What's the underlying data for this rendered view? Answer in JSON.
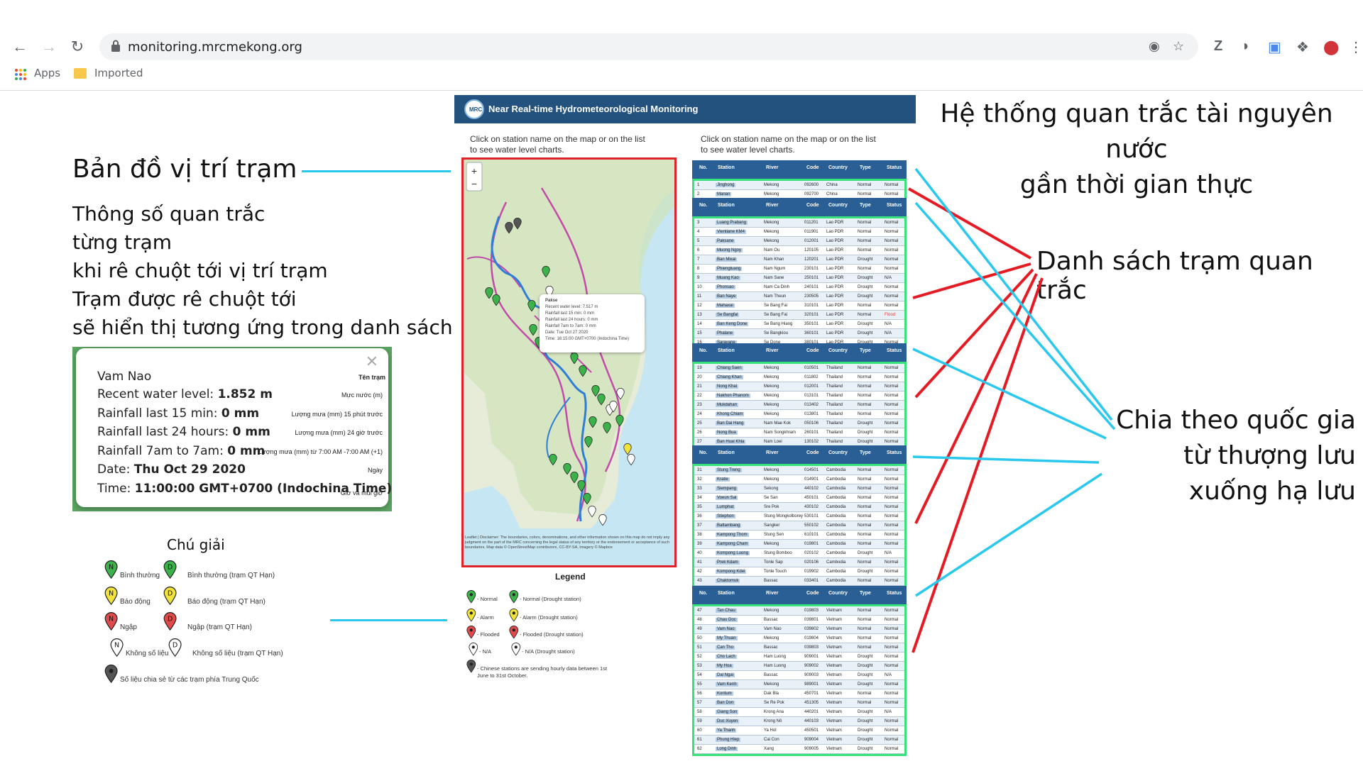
{
  "browser": {
    "url": "monitoring.mrcmekong.org",
    "bookmarks": [
      "Apps",
      "Imported"
    ],
    "ext_letter": "Z"
  },
  "annotations": {
    "map_title": "Bản đồ vị trí trạm",
    "hover_lines": [
      "Thông số quan trắc",
      "từng trạm",
      "khi rê chuột tới vị trí trạm",
      "Trạm được rê chuột tới",
      "sẽ hiển thị tương ứng trong danh sách"
    ],
    "system_lines": [
      "Hệ thống quan trắc tài nguyên nước",
      "gần thời gian thực"
    ],
    "station_list": "Danh sách trạm quan trắc",
    "country_lines": [
      "Chia theo quốc gia",
      "từ thượng lưu",
      "xuống hạ lưu"
    ],
    "legend_vi_title": "Chú giải"
  },
  "popup": {
    "station": "Vam Nao",
    "station_note": "Tên trạm",
    "rows": [
      {
        "label": "Recent water level: ",
        "value": "1.852 m",
        "note": "Mực nước (m)"
      },
      {
        "label": "Rainfall last 15 min: ",
        "value": "0 mm",
        "note": "Lượng mưa (mm) 15 phút trước"
      },
      {
        "label": "Rainfall last 24 hours: ",
        "value": "0 mm",
        "note": "Lượng mưa (mm) 24 giờ trước"
      },
      {
        "label": "Rainfall 7am to 7am: ",
        "value": "0 mm",
        "note": "Lượng mưa (mm) từ 7:00 AM -7:00 AM (+1)"
      },
      {
        "label": "Date: ",
        "value": "Thu Oct 29 2020",
        "note": "Ngày"
      },
      {
        "label": "Time: ",
        "value": "11:00:00 GMT+0700 (Indochina Time)",
        "note": "Giờ và múi giờ"
      }
    ]
  },
  "legend_vi": [
    {
      "text": "Bình thường",
      "letter": "N",
      "color": "#3bb34a"
    },
    {
      "text": "Bình thường (trạm QT Hạn)",
      "letter": "D",
      "color": "#3bb34a"
    },
    {
      "text": "Báo động",
      "letter": "N",
      "color": "#f2e33a"
    },
    {
      "text": "Báo động (trạm QT Hạn)",
      "letter": "D",
      "color": "#f2e33a"
    },
    {
      "text": "Ngập",
      "letter": "N",
      "color": "#e04a4a"
    },
    {
      "text": "Ngập (trạm QT Hạn)",
      "letter": "D",
      "color": "#e04a4a"
    },
    {
      "text": "Không số liệu",
      "letter": "N",
      "color": "#ffffff"
    },
    {
      "text": "Không số liệu (trạm QT Hạn)",
      "letter": "D",
      "color": "#ffffff"
    },
    {
      "text": "Số liệu chia sẻ từ các trạm phía Trung Quốc",
      "letter": "",
      "color": "#555555"
    }
  ],
  "portal": {
    "title": "Near Real-time Hydrometeorological Monitoring",
    "hint_left": [
      "Click on station name on the map or on the list",
      "to see water level charts."
    ],
    "hint_right": [
      "Click on station name on the map or on the list",
      "to see water level charts."
    ],
    "zoom_in": "+",
    "zoom_out": "−",
    "legend_title": "Legend",
    "legend_en": [
      {
        "text": "- Normal",
        "color": "#3bb34a"
      },
      {
        "text": "- Normal (Drought station)",
        "color": "#3bb34a"
      },
      {
        "text": "- Alarm",
        "color": "#f2e33a"
      },
      {
        "text": "- Alarm (Drought station)",
        "color": "#f2e33a"
      },
      {
        "text": "- Flooded",
        "color": "#e04a4a"
      },
      {
        "text": "- Flooded (Drought station)",
        "color": "#e04a4a"
      },
      {
        "text": "- N/A",
        "color": "#ffffff"
      },
      {
        "text": "- N/A (Drought station)",
        "color": "#ffffff"
      },
      {
        "text": "- Chinese stations are sending hourly data between 1st June to 31st October.",
        "color": "#555555"
      }
    ],
    "map_popup": {
      "station": "Pakse",
      "lines": [
        "Recent water level: 7.517 m",
        "Rainfall last 15 min: 0 mm",
        "Rainfall last 24 hours: 0 mm",
        "Rainfall 7am to 7am: 0 mm",
        "Date: Tue Oct 27 2020",
        "Time: 16:15:00 GMT+0700 (Indochina Time)"
      ]
    },
    "map_attrib": "Leaflet | Disclaimer: The boundaries, colors, denominations, and other information shown on this map do not imply any judgment on the part of the MRC concerning the legal status of any territory or the endorsement or acceptance of such boundaries. Map data © OpenStreetMap contributors, CC-BY-SA, Imagery © Mapbox",
    "table_headers": [
      "No.",
      "Station",
      "River",
      "Code",
      "Country",
      "Type",
      "Status"
    ]
  },
  "tables": [
    {
      "country": "China",
      "rows": [
        [
          "1",
          "Jinghong",
          "Mekong",
          "092600",
          "China",
          "Normal",
          "Normal"
        ],
        [
          "2",
          "Manan",
          "Mekong",
          "092700",
          "China",
          "Normal",
          "Normal"
        ]
      ]
    },
    {
      "country": "Lao PDR",
      "rows": [
        [
          "3",
          "Luang Prabang",
          "Mekong",
          "011201",
          "Lao PDR",
          "Normal",
          "Normal"
        ],
        [
          "4",
          "Vientiane KM4",
          "Mekong",
          "011901",
          "Lao PDR",
          "Normal",
          "Normal"
        ],
        [
          "5",
          "Paksane",
          "Mekong",
          "012001",
          "Lao PDR",
          "Normal",
          "Normal"
        ],
        [
          "6",
          "Muong Ngoy",
          "Nam Ou",
          "120105",
          "Lao PDR",
          "Normal",
          "Normal"
        ],
        [
          "7",
          "Ban Mixai",
          "Nam Khan",
          "120201",
          "Lao PDR",
          "Drought",
          "Normal"
        ],
        [
          "8",
          "Phiengluang",
          "Nam Ngum",
          "230101",
          "Lao PDR",
          "Normal",
          "Normal"
        ],
        [
          "9",
          "Muang Kao",
          "Nam Sane",
          "250101",
          "Lao PDR",
          "Drought",
          "N/A"
        ],
        [
          "10",
          "Phonsao",
          "Nam Ca Dinh",
          "240101",
          "Lao PDR",
          "Drought",
          "Normal"
        ],
        [
          "11",
          "Ban Naye",
          "Nam Theun",
          "230505",
          "Lao PDR",
          "Drought",
          "Normal"
        ],
        [
          "12",
          "Mahaxai",
          "Se Bang Fai",
          "310101",
          "Lao PDR",
          "Normal",
          "Normal"
        ],
        [
          "13",
          "Se Bangfai",
          "Se Bang Fai",
          "320101",
          "Lao PDR",
          "Normal",
          "Flood"
        ],
        [
          "14",
          "Ban Keng Done",
          "Se Bang Hiang",
          "350101",
          "Lao PDR",
          "Drought",
          "N/A"
        ],
        [
          "15",
          "Phalane",
          "Se Bangkiou",
          "360101",
          "Lao PDR",
          "Drought",
          "N/A"
        ],
        [
          "16",
          "Saravane",
          "Se Done",
          "380101",
          "Lao PDR",
          "Drought",
          "Normal"
        ],
        [
          "17",
          "Ban Sebangnouane",
          "Sebangnouane",
          "360106",
          "Lao PDR",
          "Drought",
          "N/A"
        ],
        [
          "18",
          "Khongsedone",
          "Nam Sedone",
          "380103",
          "Lao PDR",
          "Normal",
          "Normal"
        ]
      ]
    },
    {
      "country": "Thailand",
      "rows": [
        [
          "19",
          "Chiang Saen",
          "Mekong",
          "010501",
          "Thailand",
          "Normal",
          "Normal"
        ],
        [
          "20",
          "Chiang Khan",
          "Mekong",
          "011802",
          "Thailand",
          "Normal",
          "Normal"
        ],
        [
          "21",
          "Nong Khai",
          "Mekong",
          "012001",
          "Thailand",
          "Normal",
          "Normal"
        ],
        [
          "22",
          "Nakhon Phanom",
          "Mekong",
          "013101",
          "Thailand",
          "Normal",
          "Normal"
        ],
        [
          "23",
          "Mukdahan",
          "Mekong",
          "013402",
          "Thailand",
          "Normal",
          "Normal"
        ],
        [
          "24",
          "Khong Chiam",
          "Mekong",
          "013801",
          "Thailand",
          "Normal",
          "Normal"
        ],
        [
          "25",
          "Ban Dai Hang",
          "Nam Mae Kok",
          "050106",
          "Thailand",
          "Drought",
          "Normal"
        ],
        [
          "26",
          "Nong Bua",
          "Nam Songkhram",
          "260101",
          "Thailand",
          "Drought",
          "Normal"
        ],
        [
          "27",
          "Ban Huai Khla",
          "Nam Loei",
          "130102",
          "Thailand",
          "Drought",
          "Normal"
        ],
        [
          "28",
          "Wang Saphung",
          "Nam Loei",
          "120101",
          "Thailand",
          "Drought",
          "Normal"
        ],
        [
          "29",
          "Ban Tha Kok Daeng",
          "Nam Songkhram",
          "290102",
          "Thailand",
          "Drought",
          "Normal"
        ],
        [
          "30",
          "Ban Nong Kiang",
          "Nam Mun",
          "380104",
          "Thailand",
          "Drought",
          "Normal"
        ]
      ]
    },
    {
      "country": "Cambodia",
      "rows": [
        [
          "31",
          "Stung Treng",
          "Mekong",
          "014501",
          "Cambodia",
          "Normal",
          "Normal"
        ],
        [
          "32",
          "Kratie",
          "Mekong",
          "014901",
          "Cambodia",
          "Normal",
          "Normal"
        ],
        [
          "33",
          "Siempang",
          "Sekong",
          "440102",
          "Cambodia",
          "Normal",
          "Normal"
        ],
        [
          "34",
          "Voeun Sai",
          "Se San",
          "450101",
          "Cambodia",
          "Normal",
          "Normal"
        ],
        [
          "35",
          "Lumphat",
          "Sre Pok",
          "430102",
          "Cambodia",
          "Normal",
          "Normal"
        ],
        [
          "36",
          "Stiephon",
          "Stung Mongkolborey",
          "530101",
          "Cambodia",
          "Normal",
          "Normal"
        ],
        [
          "37",
          "Battambang",
          "Sangker",
          "550102",
          "Cambodia",
          "Normal",
          "Normal"
        ],
        [
          "38",
          "Kampong Thom",
          "Stung Sen",
          "610101",
          "Cambodia",
          "Normal",
          "Normal"
        ],
        [
          "39",
          "Kampong Cham",
          "Mekong",
          "019801",
          "Cambodia",
          "Normal",
          "Normal"
        ],
        [
          "40",
          "Kompong Luong",
          "Stung Bomboo",
          "020102",
          "Cambodia",
          "Drought",
          "N/A"
        ],
        [
          "41",
          "Prek Kdam",
          "Tonle Sap",
          "020106",
          "Cambodia",
          "Normal",
          "Normal"
        ],
        [
          "42",
          "Kompong Kdei",
          "Tonle Touch",
          "019902",
          "Cambodia",
          "Drought",
          "Normal"
        ],
        [
          "43",
          "Chaktomuk",
          "Bassac",
          "033401",
          "Cambodia",
          "Normal",
          "Normal"
        ],
        [
          "44",
          "Koh Khel",
          "Bassac",
          "033402",
          "Cambodia",
          "Normal",
          "Normal"
        ],
        [
          "45",
          "Prek Thnot",
          "Stung Prek Thnot",
          "620101",
          "Cambodia",
          "Drought",
          "Normal"
        ],
        [
          "46",
          "Angkorborey",
          "Stung Angkor Borei",
          "680103",
          "Cambodia",
          "Drought",
          "Normal"
        ]
      ]
    },
    {
      "country": "Viet Nam",
      "rows": [
        [
          "47",
          "Tan Chau",
          "Mekong",
          "019803",
          "Vietnam",
          "Normal",
          "Normal"
        ],
        [
          "48",
          "Chau Doc",
          "Bassac",
          "039801",
          "Vietnam",
          "Normal",
          "Normal"
        ],
        [
          "49",
          "Vam Nao",
          "Vam Nao",
          "039802",
          "Vietnam",
          "Normal",
          "Normal"
        ],
        [
          "50",
          "My Thuan",
          "Mekong",
          "019804",
          "Vietnam",
          "Normal",
          "Normal"
        ],
        [
          "51",
          "Can Tho",
          "Bassac",
          "039803",
          "Vietnam",
          "Normal",
          "Normal"
        ],
        [
          "52",
          "Cho Lach",
          "Ham Luong",
          "909001",
          "Vietnam",
          "Drought",
          "Normal"
        ],
        [
          "53",
          "My Hoa",
          "Ham Luong",
          "909002",
          "Vietnam",
          "Drought",
          "Normal"
        ],
        [
          "54",
          "Dai Ngai",
          "Bassac",
          "909003",
          "Vietnam",
          "Drought",
          "N/A"
        ],
        [
          "55",
          "Vam Kenh",
          "Mekong",
          "989001",
          "Vietnam",
          "Drought",
          "Normal"
        ],
        [
          "56",
          "Kontum",
          "Dak Bla",
          "450701",
          "Vietnam",
          "Normal",
          "Normal"
        ],
        [
          "57",
          "Ban Don",
          "Se Re Pok",
          "451305",
          "Vietnam",
          "Normal",
          "Normal"
        ],
        [
          "58",
          "Giang Son",
          "Krong Ana",
          "440201",
          "Vietnam",
          "Drought",
          "N/A"
        ],
        [
          "59",
          "Duc Xuyen",
          "Krong Nô",
          "440103",
          "Vietnam",
          "Drought",
          "Normal"
        ],
        [
          "60",
          "Ya Thanh",
          "Ya Hol",
          "450501",
          "Vietnam",
          "Drought",
          "Normal"
        ],
        [
          "61",
          "Phung Hiep",
          "Cai Con",
          "909004",
          "Vietnam",
          "Drought",
          "Normal"
        ],
        [
          "62",
          "Long Dinh",
          "Xang",
          "909005",
          "Vietnam",
          "Drought",
          "Normal"
        ]
      ]
    }
  ]
}
